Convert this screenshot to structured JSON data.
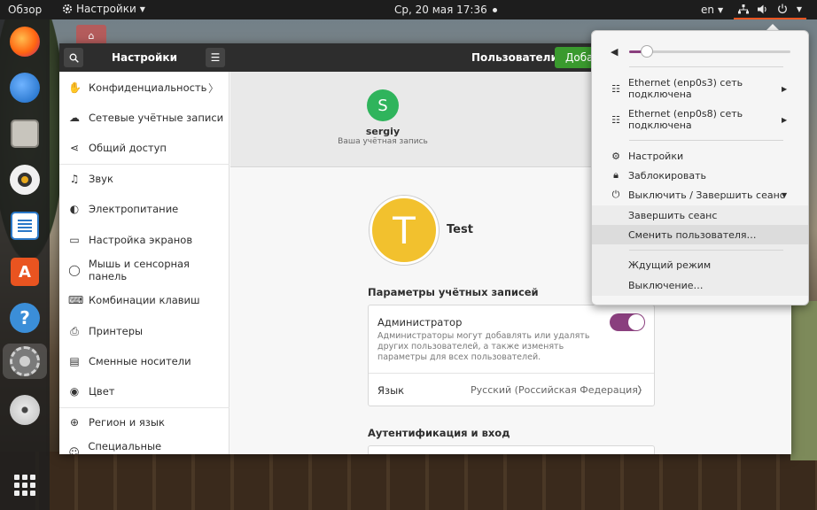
{
  "topbar": {
    "overview": "Обзор",
    "app_menu": "Настройки",
    "clock": "Ср, 20 мая  17:36",
    "lang": "en"
  },
  "desktop": {
    "home_icon_glyph": "⌂"
  },
  "window": {
    "sidebar_title": "Настройки",
    "page_title": "Пользователи",
    "add_button": "Доба",
    "sidebar": [
      {
        "label": "Конфиденциальность",
        "icon": "hand-icon",
        "glyph": "✋",
        "chevron": "〉"
      },
      {
        "label": "Сетевые учётные записи",
        "icon": "cloud-icon",
        "glyph": "☁"
      },
      {
        "label": "Общий доступ",
        "icon": "share-icon",
        "glyph": "⋖"
      },
      {
        "label": "Звук",
        "icon": "music-note-icon",
        "glyph": "♫"
      },
      {
        "label": "Электропитание",
        "icon": "power-icon",
        "glyph": "◐"
      },
      {
        "label": "Настройка экранов",
        "icon": "display-icon",
        "glyph": "▭"
      },
      {
        "label": "Мышь и сенсорная панель",
        "icon": "mouse-icon",
        "glyph": "◯"
      },
      {
        "label": "Комбинации клавиш",
        "icon": "keyboard-icon",
        "glyph": "⌨"
      },
      {
        "label": "Принтеры",
        "icon": "printer-icon",
        "glyph": "⎙"
      },
      {
        "label": "Сменные носители",
        "icon": "media-icon",
        "glyph": "▤"
      },
      {
        "label": "Цвет",
        "icon": "color-icon",
        "glyph": "◉"
      },
      {
        "label": "Регион и язык",
        "icon": "globe-icon",
        "glyph": "⊕"
      },
      {
        "label": "Специальные возможности",
        "icon": "accessibility-icon",
        "glyph": "☺"
      }
    ],
    "user_strip": {
      "avatar_letter": "S",
      "name": "sergiy",
      "subtitle": "Ваша учётная запись"
    },
    "user": {
      "avatar_letter": "T",
      "name": "Test"
    },
    "accounts_section": "Параметры учётных записей",
    "admin_title": "Администратор",
    "admin_desc": "Администраторы могут добавлять или удалять других пользователей, а также изменять параметры для всех пользователей.",
    "admin_enabled": true,
    "language_label": "Язык",
    "language_value": "Русский (Российская Федерация)",
    "language_chevron": "〉",
    "auth_section": "Аутентификация и вход"
  },
  "menu": {
    "volume_level": 0.08,
    "ethernet1": "Ethernet (enp0s3) сеть подключена",
    "ethernet2": "Ethernet (enp0s8) сеть подключена",
    "settings": "Настройки",
    "lock": "Заблокировать",
    "power_off_logout": "Выключить / Завершить сеанс",
    "logout": "Завершить сеанс",
    "switch_user": "Сменить пользователя…",
    "suspend": "Ждущий режим",
    "power_off": "Выключение…"
  },
  "colors": {
    "accent": "#8a3f7e",
    "ubuntu_orange": "#e95420",
    "add_green": "#3a9a2e"
  }
}
